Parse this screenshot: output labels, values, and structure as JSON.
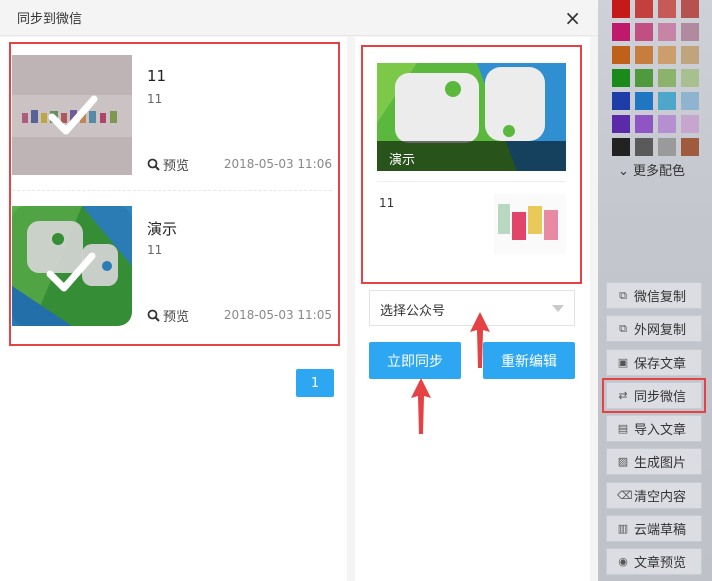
{
  "dialog": {
    "title": "同步到微信",
    "close": "×"
  },
  "articles": [
    {
      "title": "11",
      "digest": "11",
      "preview": "预览",
      "date": "2018-05-03 11:06"
    },
    {
      "title": "演示",
      "digest": "11",
      "preview": "预览",
      "date": "2018-05-03 11:05"
    }
  ],
  "pager": {
    "current": "1"
  },
  "wechat_preview": {
    "cover_title": "演示",
    "sub_title": "11"
  },
  "account_select": {
    "value": "选择公众号"
  },
  "buttons": {
    "sync_now": "立即同步",
    "re_edit": "重新编辑"
  },
  "sidebar": {
    "more_colors": "更多配色",
    "items": [
      {
        "label": "微信复制",
        "icon": "copy-icon"
      },
      {
        "label": "外网复制",
        "icon": "copy-icon"
      },
      {
        "label": "保存文章",
        "icon": "save-icon"
      },
      {
        "label": "同步微信",
        "icon": "sync-icon"
      },
      {
        "label": "导入文章",
        "icon": "import-icon"
      },
      {
        "label": "生成图片",
        "icon": "image-icon"
      },
      {
        "label": "清空内容",
        "icon": "trash-icon"
      },
      {
        "label": "云端草稿",
        "icon": "cloud-draft-icon"
      },
      {
        "label": "文章预览",
        "icon": "eye-icon"
      }
    ]
  },
  "colors": {
    "accent": "#2ea7f3",
    "highlight": "#e54245"
  }
}
